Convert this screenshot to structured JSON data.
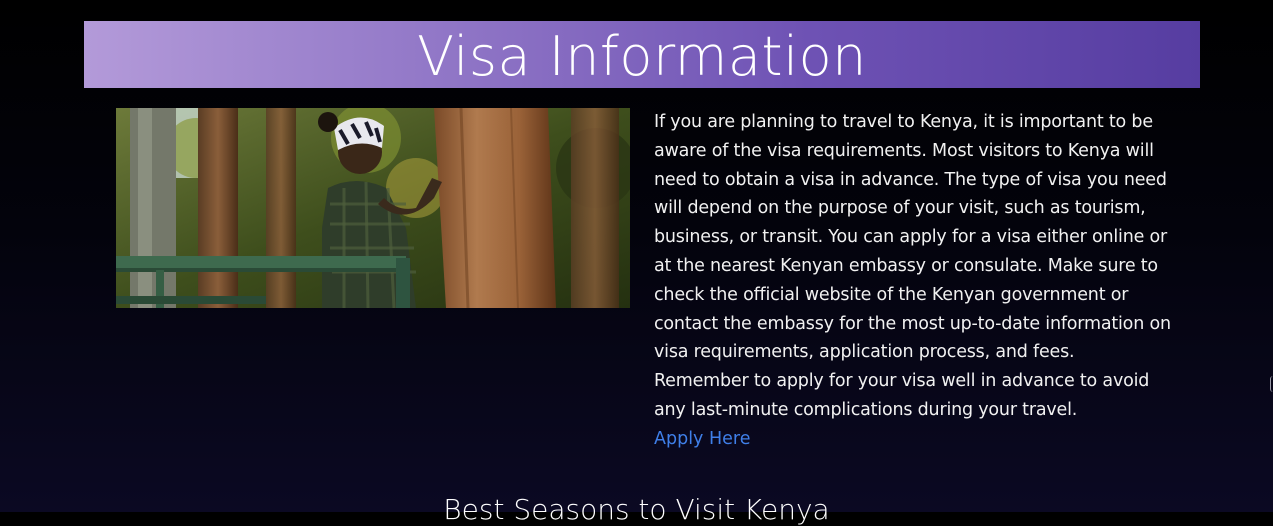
{
  "header": {
    "title": "Visa Information"
  },
  "image": {
    "subject": "traveler-photographing-tree-in-forest"
  },
  "visa_section": {
    "paragraph": "If you are planning to travel to Kenya, it is important to be aware of the visa requirements. Most visitors to Kenya will need to obtain a visa in advance. The type of visa you need will depend on the purpose of your visit, such as tourism, business, or transit. You can apply for a visa either online or at the nearest Kenyan embassy or consulate. Make sure to check the official website of the Kenyan government or contact the embassy for the most up-to-date information on visa requirements, application process, and fees. Remember to apply for your visa well in advance to avoid any last-minute complications during your travel.",
    "link_label": "Apply Here"
  },
  "next_section": {
    "title": "Best Seasons to Visit Kenya"
  },
  "colors": {
    "background": "#000000",
    "header_gradient_start": "#b39ad9",
    "header_gradient_end": "#563da1",
    "link": "#3f7fe8",
    "text": "#f1f1f1"
  }
}
